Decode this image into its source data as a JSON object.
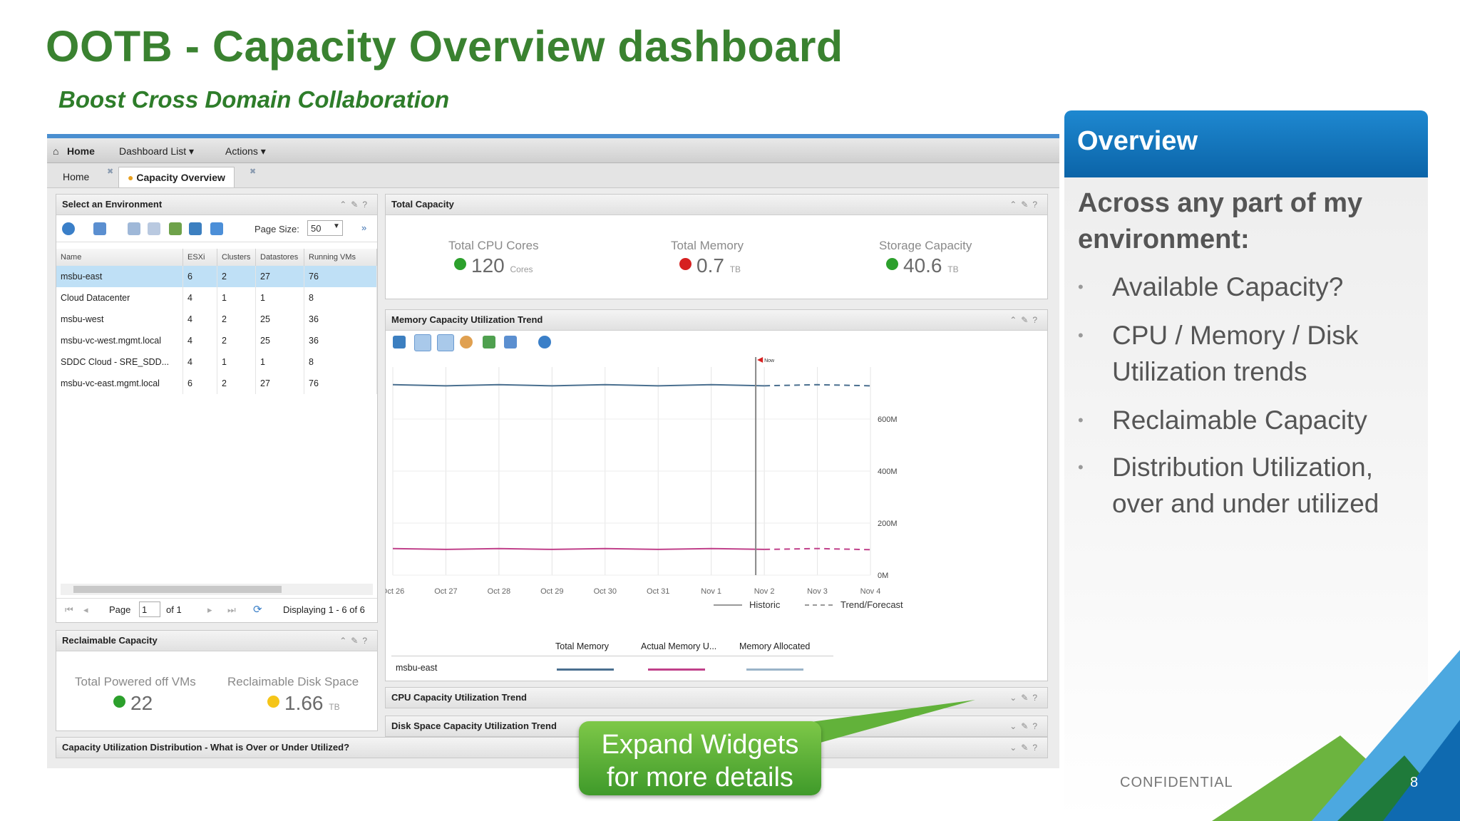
{
  "slide": {
    "title": "OOTB - Capacity Overview dashboard",
    "subtitle": "Boost Cross Domain Collaboration",
    "confidential": "CONFIDENTIAL",
    "page_number": "8"
  },
  "menubar": {
    "home": "Home",
    "dashboard_list": "Dashboard List ▾",
    "actions": "Actions ▾"
  },
  "tabs": [
    {
      "label": "Home"
    },
    {
      "label": "Capacity Overview"
    }
  ],
  "env_widget": {
    "title": "Select an Environment",
    "page_size_label": "Page Size:",
    "page_size": "50",
    "columns": [
      "Name",
      "ESXi",
      "Clusters",
      "Datastores",
      "Running VMs"
    ],
    "rows": [
      [
        "msbu-east",
        "6",
        "2",
        "27",
        "76"
      ],
      [
        "Cloud Datacenter",
        "4",
        "1",
        "1",
        "8"
      ],
      [
        "msbu-west",
        "4",
        "2",
        "25",
        "36"
      ],
      [
        "msbu-vc-west.mgmt.local",
        "4",
        "2",
        "25",
        "36"
      ],
      [
        "SDDC Cloud - SRE_SDD...",
        "4",
        "1",
        "1",
        "8"
      ],
      [
        "msbu-vc-east.mgmt.local",
        "6",
        "2",
        "27",
        "76"
      ]
    ],
    "pager_page_label": "Page",
    "pager_page": "1",
    "pager_of": "of 1",
    "pager_display": "Displaying 1 - 6 of 6"
  },
  "reclaimable": {
    "title": "Reclaimable Capacity",
    "powered_off_label": "Total Powered off VMs",
    "powered_off_value": "22",
    "disk_label": "Reclaimable Disk Space",
    "disk_value": "1.66",
    "disk_unit": "TB"
  },
  "total_capacity": {
    "title": "Total Capacity",
    "cpu_label": "Total CPU Cores",
    "cpu_value": "120",
    "cpu_unit": "Cores",
    "mem_label": "Total Memory",
    "mem_value": "0.7",
    "mem_unit": "TB",
    "storage_label": "Storage Capacity",
    "storage_value": "40.6",
    "storage_unit": "TB"
  },
  "memory_trend": {
    "title": "Memory Capacity Utilization Trend",
    "now_label": "Now",
    "historic_label": "Historic",
    "forecast_label": "Trend/Forecast",
    "legend_headers": [
      "Total Memory",
      "Actual Memory U...",
      "Memory Allocated"
    ],
    "legend_row": "msbu-east"
  },
  "chart_data": {
    "type": "line",
    "x": [
      "Oct 26",
      "Oct 27",
      "Oct 28",
      "Oct 29",
      "Oct 30",
      "Oct 31",
      "Nov 1",
      "Nov 2",
      "Nov 3",
      "Nov 4"
    ],
    "yticks": [
      "0M",
      "200M",
      "400M",
      "600M"
    ],
    "ylim": [
      0,
      800
    ],
    "now_index": 7,
    "series": [
      {
        "name": "Total Memory",
        "color": "#4a6f8f",
        "values": [
          730,
          730,
          730,
          730,
          730,
          730,
          730,
          730,
          730,
          730
        ]
      },
      {
        "name": "Actual Memory U...",
        "color": "#c0408a",
        "values": [
          100,
          101,
          100,
          101,
          100,
          101,
          100,
          101,
          100,
          100
        ]
      },
      {
        "name": "Memory Allocated",
        "color": "#9ab3c8",
        "values": []
      }
    ]
  },
  "cpu_trend": {
    "title": "CPU Capacity Utilization Trend"
  },
  "disk_trend": {
    "title": "Disk Space Capacity Utilization Trend"
  },
  "distribution": {
    "title": "Capacity Utilization Distribution - What is Over or Under Utilized?"
  },
  "callout": {
    "line1": "Expand Widgets",
    "line2": "for more details"
  },
  "overview": {
    "header": "Overview",
    "lead": "Across any part of my environment:",
    "bullets": [
      "Available Capacity?",
      "CPU / Memory / Disk Utilization trends",
      "Reclaimable Capacity",
      "Distribution Utilization, over and under utilized"
    ]
  },
  "colors": {
    "green": "#2ca02c",
    "red": "#d62020",
    "yellow": "#f5c518",
    "accent": "#0b64a8"
  }
}
